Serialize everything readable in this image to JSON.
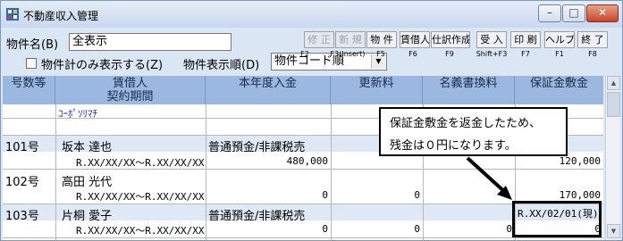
{
  "window": {
    "title": "不動産収入管理",
    "minimize": "–",
    "maximize": "□",
    "close": "✕"
  },
  "filter": {
    "property_label": "物件名(B)",
    "property_value": "全表示",
    "only_totals_label": "物件計のみ表示する(Z)",
    "order_label": "物件表示順(D)",
    "order_value": "物件コード順"
  },
  "function_keys": [
    {
      "label": "修 正",
      "key": "F2",
      "enabled": false
    },
    {
      "label": "新 規",
      "key": "F3(Insert)",
      "enabled": false
    },
    {
      "label": "物 件",
      "key": "F5",
      "enabled": true
    },
    {
      "label": "賃借人",
      "key": "F6",
      "enabled": true
    },
    {
      "label": "仕訳作成",
      "key": "F9",
      "enabled": true
    },
    {
      "label": "受 入",
      "key": "Shift+F3",
      "enabled": true
    },
    {
      "label": "印 刷",
      "key": "F7",
      "enabled": true
    },
    {
      "label": "ヘルプ",
      "key": "F1",
      "enabled": true
    },
    {
      "label": "終 了",
      "key": "F8",
      "enabled": true
    }
  ],
  "table": {
    "headers": {
      "room": "号数等",
      "tenant": "賃借人",
      "period": "契約期間",
      "income": "本年度入金",
      "renewal": "更新料",
      "transfer": "名義書換料",
      "deposit": "保証金敷金"
    },
    "building": "ｺｰﾎﾟｿﾘﾏﾁ",
    "rows": [
      {
        "room": "101号",
        "tenant": "坂本 達也",
        "income_type": "普通預金/非課税売",
        "period": "R.XX/XX/XX～R.XX/XX/XX",
        "income": "480,000",
        "renewal": "",
        "transfer": "",
        "deposit": "120,000"
      },
      {
        "room": "102号",
        "tenant": "高田 光代",
        "income_type": "",
        "period": "R.XX/XX/XX～R.XX/XX/XX",
        "income": "0",
        "renewal": "0",
        "transfer": "",
        "deposit": "170,000"
      },
      {
        "room": "103号",
        "tenant": "片桐 愛子",
        "income_type": "普通預金/非課税売",
        "period": "R.XX/XX/XX～R.XX/XX/XX",
        "income": "0",
        "renewal": "0",
        "transfer": "0",
        "deposit_date": "R.XX/02/01(現)",
        "deposit": "0"
      }
    ]
  },
  "callout": {
    "line1": "保証金敷金を返金したため、",
    "line2": "残金は０円になります。"
  },
  "colors": {
    "header_bg": "#9ab8e0",
    "row_shade": "#dfe8f4",
    "window_bg": "#dbe6f4"
  }
}
